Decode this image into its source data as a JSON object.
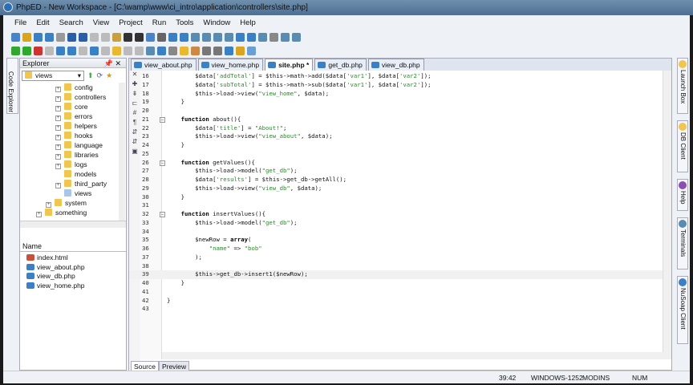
{
  "window": {
    "title": "PhpED - New Workspace - [C:\\wamp\\www\\ci_intro\\application\\controllers\\site.php]"
  },
  "menu": [
    "File",
    "Edit",
    "Search",
    "View",
    "Project",
    "Run",
    "Tools",
    "Window",
    "Help"
  ],
  "left_tab": "Code Explorer",
  "explorer": {
    "title": "Explorer",
    "folder_select": "views",
    "tree": [
      {
        "label": "config",
        "indent": 2,
        "plus": true
      },
      {
        "label": "controllers",
        "indent": 2,
        "plus": true
      },
      {
        "label": "core",
        "indent": 2,
        "plus": true
      },
      {
        "label": "errors",
        "indent": 2,
        "plus": true
      },
      {
        "label": "helpers",
        "indent": 2,
        "plus": true
      },
      {
        "label": "hooks",
        "indent": 2,
        "plus": true
      },
      {
        "label": "language",
        "indent": 2,
        "plus": true
      },
      {
        "label": "libraries",
        "indent": 2,
        "plus": true
      },
      {
        "label": "logs",
        "indent": 2,
        "plus": true
      },
      {
        "label": "models",
        "indent": 2,
        "plus": false
      },
      {
        "label": "third_party",
        "indent": 2,
        "plus": true
      },
      {
        "label": "views",
        "indent": 2,
        "plus": false,
        "selected": true
      },
      {
        "label": "system",
        "indent": 1,
        "plus": true
      },
      {
        "label": "something",
        "indent": 0,
        "plus": true
      }
    ],
    "files_header": "Name",
    "files": [
      "index.html",
      "view_about.php",
      "view_db.php",
      "view_home.php"
    ]
  },
  "editor": {
    "tabs": [
      {
        "label": "view_about.php"
      },
      {
        "label": "view_home.php"
      },
      {
        "label": "site.php *",
        "active": true
      },
      {
        "label": "get_db.php"
      },
      {
        "label": "view_db.php"
      }
    ],
    "current_line": 39,
    "lines": [
      {
        "n": 16,
        "t": "        $data['addTotal'] = $this->math->add($data['var1'], $data['var2']);"
      },
      {
        "n": 17,
        "t": "        $data['subTotal'] = $this->math->sub($data['var1'], $data['var2']);"
      },
      {
        "n": 18,
        "t": "        $this->load->view(\"view_home\", $data);"
      },
      {
        "n": 19,
        "t": "    }"
      },
      {
        "n": 20,
        "t": ""
      },
      {
        "n": 21,
        "t": "    function about(){",
        "fold": true
      },
      {
        "n": 22,
        "t": "        $data['title'] = \"About!\";"
      },
      {
        "n": 23,
        "t": "        $this->load->view(\"view_about\", $data);"
      },
      {
        "n": 24,
        "t": "    }"
      },
      {
        "n": 25,
        "t": ""
      },
      {
        "n": 26,
        "t": "    function getValues(){",
        "fold": true
      },
      {
        "n": 27,
        "t": "        $this->load->model(\"get_db\");"
      },
      {
        "n": 28,
        "t": "        $data['results'] = $this->get_db->getAll();"
      },
      {
        "n": 29,
        "t": "        $this->load->view(\"view_db\", $data);"
      },
      {
        "n": 30,
        "t": "    }"
      },
      {
        "n": 31,
        "t": ""
      },
      {
        "n": 32,
        "t": "    function insertValues(){",
        "fold": true
      },
      {
        "n": 33,
        "t": "        $this->load->model(\"get_db\");"
      },
      {
        "n": 34,
        "t": ""
      },
      {
        "n": 35,
        "t": "        $newRow = array("
      },
      {
        "n": 36,
        "t": "            \"name\" => \"bob\""
      },
      {
        "n": 37,
        "t": "        );"
      },
      {
        "n": 38,
        "t": ""
      },
      {
        "n": 39,
        "t": "        $this->get_db->insert1($newRow);"
      },
      {
        "n": 40,
        "t": "    }"
      },
      {
        "n": 41,
        "t": ""
      },
      {
        "n": 42,
        "t": "}"
      },
      {
        "n": 43,
        "t": ""
      }
    ],
    "bottom_tabs": [
      "Source",
      "Preview"
    ]
  },
  "right_tabs": [
    {
      "label": "Launch Box",
      "color": "#f0c550"
    },
    {
      "label": "DB Client",
      "color": "#f0c550"
    },
    {
      "label": "Help",
      "color": "#8a4fb3"
    },
    {
      "label": "Terminals",
      "color": "#5a8bb0"
    },
    {
      "label": "NuSoap Client",
      "color": "#3b7fc4"
    }
  ],
  "status": {
    "position": "39:42",
    "encoding": "WINDOWS-1252",
    "mod": "MOD",
    "ins": "INS",
    "num": "NUM"
  }
}
